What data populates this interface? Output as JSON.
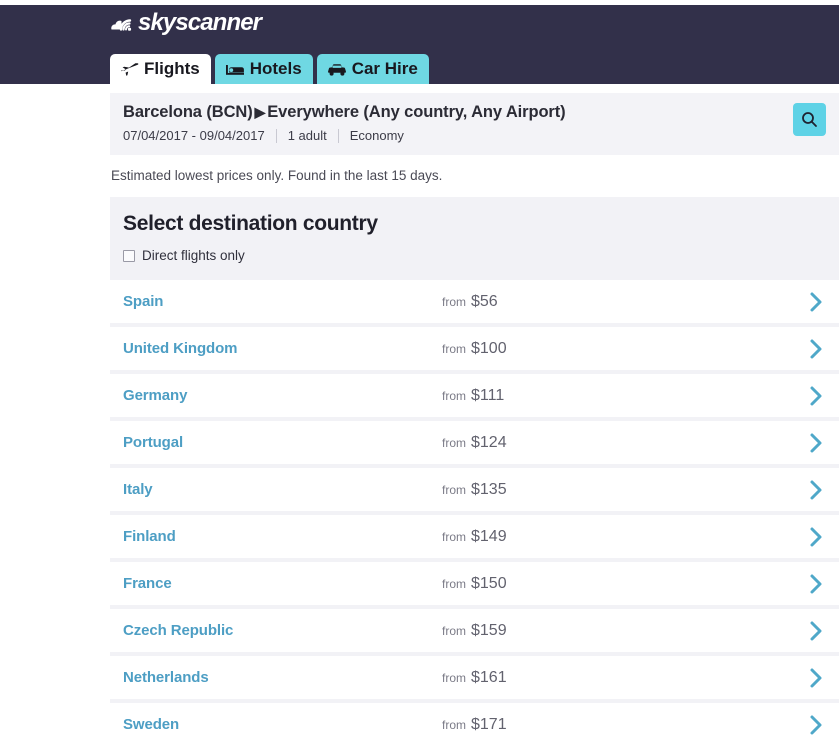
{
  "brand": {
    "logo_text": "skyscanner",
    "logo_icon": "skyscanner-cloud-wifi-icon",
    "header_color": "#32304a",
    "accent_color": "#6fd8e3",
    "link_color": "#4d9ec4"
  },
  "tabs": [
    {
      "label": "Flights",
      "icon": "airplane-icon",
      "active": true
    },
    {
      "label": "Hotels",
      "icon": "bed-icon",
      "active": false
    },
    {
      "label": "Car Hire",
      "icon": "car-icon",
      "active": false
    }
  ],
  "search_summary": {
    "origin": "Barcelona (BCN)",
    "arrow": "▶",
    "destination": "Everywhere (Any country, Any Airport)",
    "dates": "07/04/2017 - 09/04/2017",
    "passengers": "1 adult",
    "cabin_class": "Economy",
    "search_button_icon": "search-icon"
  },
  "note": "Estimated lowest prices only. Found in the last 15 days.",
  "panel": {
    "title": "Select destination country",
    "direct_flights_label": "Direct flights only",
    "direct_flights_checked": false
  },
  "price_prefix": "from",
  "chevron_icon": "chevron-right-icon",
  "results": [
    {
      "country": "Spain",
      "price": "$56"
    },
    {
      "country": "United Kingdom",
      "price": "$100"
    },
    {
      "country": "Germany",
      "price": "$111"
    },
    {
      "country": "Portugal",
      "price": "$124"
    },
    {
      "country": "Italy",
      "price": "$135"
    },
    {
      "country": "Finland",
      "price": "$149"
    },
    {
      "country": "France",
      "price": "$150"
    },
    {
      "country": "Czech Republic",
      "price": "$159"
    },
    {
      "country": "Netherlands",
      "price": "$161"
    },
    {
      "country": "Sweden",
      "price": "$171"
    }
  ]
}
